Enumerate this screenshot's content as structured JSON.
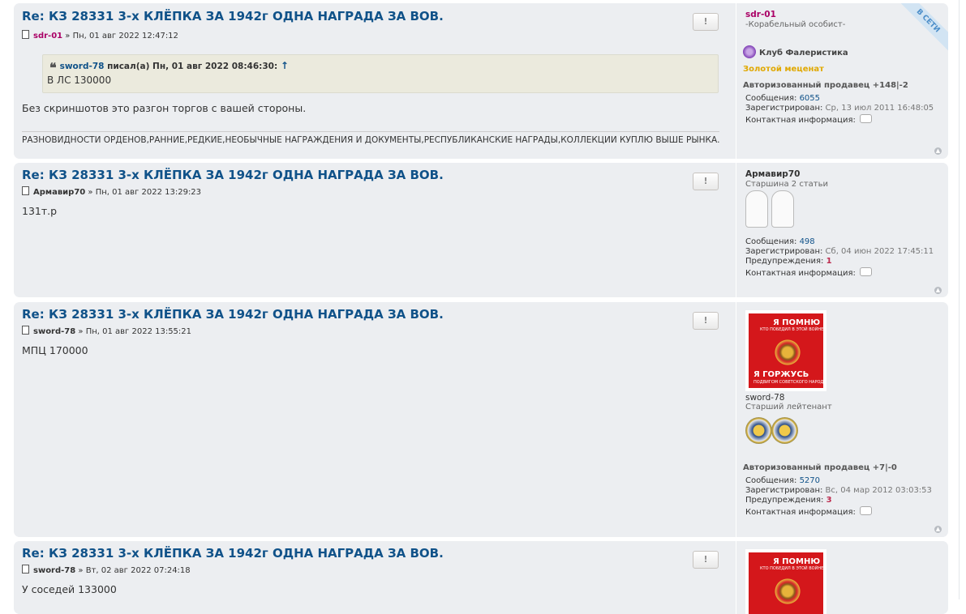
{
  "colors": {
    "post_bg": "#eceef1",
    "title": "#105289",
    "purple_user": "#aa0066",
    "warning": "#bc2a4d",
    "gold": "#e0a800"
  },
  "icons": {
    "file": "file-icon",
    "report": "report-icon",
    "top": "back-to-top-icon",
    "contact": "contact-icon",
    "club": "club-icon"
  },
  "posts": [
    {
      "title": "Re: КЗ 28331 3-х КЛЁПКА ЗА 1942г ОДНА НАГРАДА ЗА ВОВ.",
      "author": "sdr-01",
      "date_sep": " » ",
      "date": "Пн, 01 авг 2022 12:47:12",
      "report_label": "!",
      "quote": {
        "author": "sword-78",
        "wrote": " писал(а) Пн, 01 авг 2022 08:46:30: ",
        "up": "↑",
        "text": "В ЛС 130000"
      },
      "text": "Без скриншотов это разгон торгов с вашей стороны.",
      "signature": "РАЗНОВИДНОСТИ ОРДЕНОВ,РАННИЕ,РЕДКИЕ,НЕОБЫЧНЫЕ НАГРАЖДЕНИЯ И ДОКУМЕНТЫ,РЕСПУБЛИКАНСКИЕ НАГРАДЫ,КОЛЛЕКЦИИ КУПЛЮ ВЫШЕ РЫНКА.",
      "profile": {
        "online": "В СЕТИ",
        "name": "sdr-01",
        "rank": "-Корабельный особист-",
        "club": "Клуб Фалеристика",
        "gold": "Золотой меценат",
        "seller": "Авторизованный продавец +148|-2",
        "posts_label": "Сообщения: ",
        "posts": "6055",
        "reg_label": "Зарегистрирован: ",
        "reg": "Ср, 13 июл 2011 16:48:05",
        "contact_label": "Контактная информация: "
      }
    },
    {
      "title": "Re: КЗ 28331 3-х КЛЁПКА ЗА 1942г ОДНА НАГРАДА ЗА ВОВ.",
      "author": "Армавир70",
      "date_sep": " » ",
      "date": "Пн, 01 авг 2022 13:29:23",
      "report_label": "!",
      "text": "131т.р",
      "profile": {
        "name": "Армавир70",
        "rank": "Старшина 2 статьи",
        "posts_label": "Сообщения: ",
        "posts": "498",
        "reg_label": "Зарегистрирован: ",
        "reg": "Сб, 04 июн 2022 17:45:11",
        "warn_label": "Предупреждения: ",
        "warn": "1",
        "contact_label": "Контактная информация: "
      }
    },
    {
      "title": "Re: КЗ 28331 3-х КЛЁПКА ЗА 1942г ОДНА НАГРАДА ЗА ВОВ.",
      "author": "sword-78",
      "date_sep": " » ",
      "date": "Пн, 01 авг 2022 13:55:21",
      "report_label": "!",
      "text": "МПЦ 170000",
      "profile": {
        "avatar_t1": "Я ПОМНЮ",
        "avatar_t2": "КТО ПОБЕДИЛ В ЭТОЙ ВОЙНЕ",
        "avatar_t3": "Я ГОРЖУСЬ",
        "avatar_t4": "ПОДВИГОМ СОВЕТСКОГО НАРОДА",
        "name": "sword-78",
        "rank": "Старший лейтенант",
        "seller": "Авторизованный продавец +7|-0",
        "posts_label": "Сообщения: ",
        "posts": "5270",
        "reg_label": "Зарегистрирован: ",
        "reg": "Вс, 04 мар 2012 03:03:53",
        "warn_label": "Предупреждения: ",
        "warn": "3",
        "contact_label": "Контактная информация: "
      }
    },
    {
      "title": "Re: КЗ 28331 3-х КЛЁПКА ЗА 1942г ОДНА НАГРАДА ЗА ВОВ.",
      "author": "sword-78",
      "date_sep": " » ",
      "date": "Вт, 02 авг 2022 07:24:18",
      "report_label": "!",
      "text": "У соседей 133000",
      "profile": {
        "avatar_t1": "Я ПОМНЮ",
        "avatar_t2": "КТО ПОБЕДИЛ В ЭТОЙ ВОЙНЕ"
      }
    }
  ]
}
